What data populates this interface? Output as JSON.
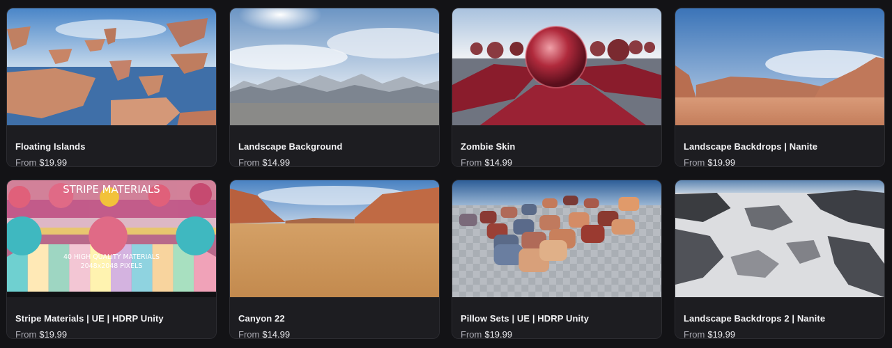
{
  "products": [
    {
      "title": "Floating Islands",
      "price_prefix": "From",
      "price": "$19.99"
    },
    {
      "title": "Landscape Background",
      "price_prefix": "From",
      "price": "$14.99"
    },
    {
      "title": "Zombie Skin",
      "price_prefix": "From",
      "price": "$14.99"
    },
    {
      "title": "Landscape Backdrops | Nanite",
      "price_prefix": "From",
      "price": "$19.99"
    },
    {
      "title": "Stripe Materials | UE | HDRP Unity",
      "price_prefix": "From",
      "price": "$19.99",
      "overlay_title": "STRIPE MATERIALS",
      "overlay_line1": "40 HIGH QUALITY MATERIALS",
      "overlay_line2": "2048x2048 PIXELS"
    },
    {
      "title": "Canyon 22",
      "price_prefix": "From",
      "price": "$14.99"
    },
    {
      "title": "Pillow Sets | UE | HDRP Unity",
      "price_prefix": "From",
      "price": "$19.99"
    },
    {
      "title": "Landscape Backdrops 2 | Nanite",
      "price_prefix": "From",
      "price": "$19.99"
    }
  ],
  "colors": {
    "page_bg": "#131316",
    "card_bg": "#1d1d21",
    "title_text": "#f2f2f4",
    "price_label": "#a8a8b0"
  }
}
